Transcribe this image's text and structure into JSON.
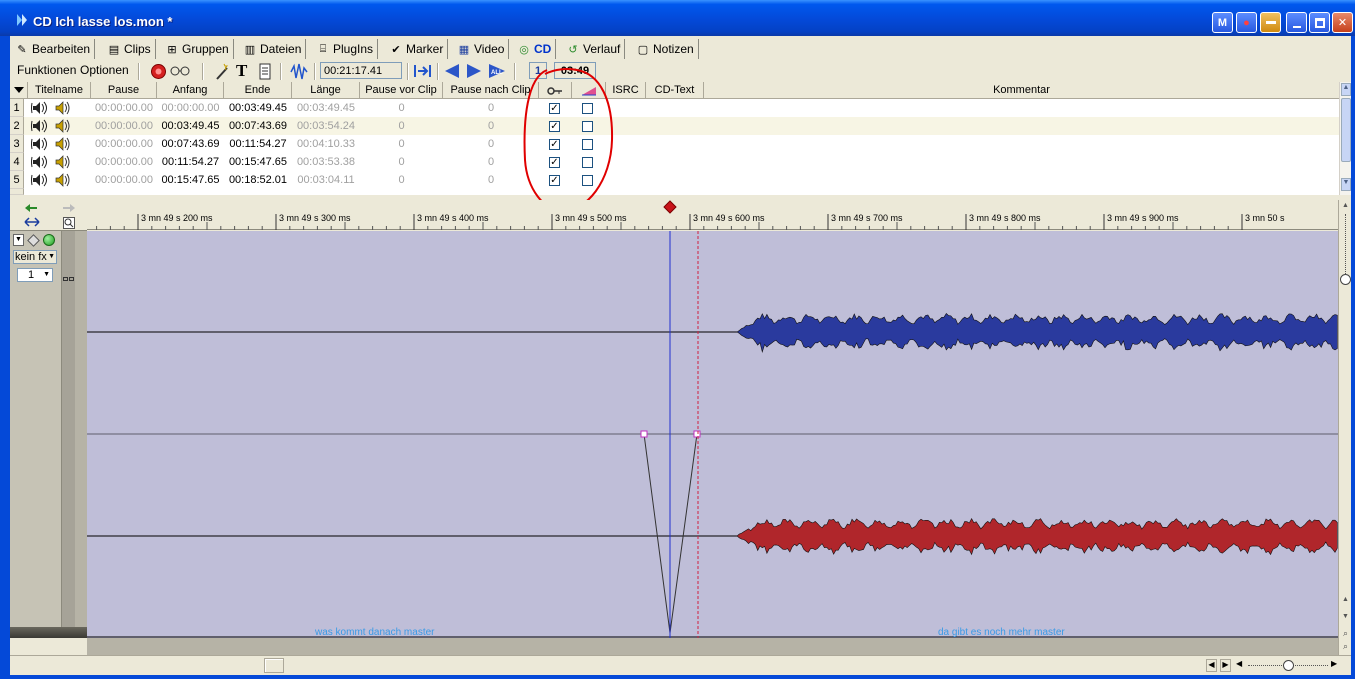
{
  "window": {
    "title": "CD Ich lasse los.mon *",
    "buttons": [
      "M",
      "●",
      "",
      "",
      "",
      "✕"
    ]
  },
  "tabs": [
    {
      "label": "Bearbeiten",
      "icon": "edit-icon"
    },
    {
      "label": "Clips",
      "icon": "clips-icon"
    },
    {
      "label": "Gruppen",
      "icon": "groups-icon"
    },
    {
      "label": "Dateien",
      "icon": "files-icon"
    },
    {
      "label": "PlugIns",
      "icon": "plugins-icon"
    },
    {
      "label": "Marker",
      "icon": "marker-icon"
    },
    {
      "label": "Video",
      "icon": "video-icon"
    },
    {
      "label": "CD",
      "icon": "cd-icon",
      "active": true
    },
    {
      "label": "Verlauf",
      "icon": "history-icon"
    },
    {
      "label": "Notizen",
      "icon": "notes-icon"
    }
  ],
  "toolbar": {
    "menu_functions": "Funktionen",
    "menu_options": "Optionen",
    "total_time": "00:21:17.41",
    "track_number": "1",
    "track_length": "03:49"
  },
  "table": {
    "columns": [
      "Titelname",
      "Pause",
      "Anfang",
      "Ende",
      "Länge",
      "Pause vor Clip",
      "Pause nach Clip",
      "",
      "",
      "ISRC",
      "CD-Text",
      "Kommentar"
    ],
    "rows": [
      {
        "num": "1",
        "pause": "00:00:00.00",
        "start": "00:00:00.00",
        "end": "00:03:49.45",
        "length": "00:03:49.45",
        "pre": "0",
        "post": "0",
        "checked": true,
        "emph": false
      },
      {
        "num": "2",
        "pause": "00:00:00.00",
        "start": "00:03:49.45",
        "end": "00:07:43.69",
        "length": "00:03:54.24",
        "pre": "0",
        "post": "0",
        "checked": true,
        "emph": false
      },
      {
        "num": "3",
        "pause": "00:00:00.00",
        "start": "00:07:43.69",
        "end": "00:11:54.27",
        "length": "00:04:10.33",
        "pre": "0",
        "post": "0",
        "checked": true,
        "emph": false
      },
      {
        "num": "4",
        "pause": "00:00:00.00",
        "start": "00:11:54.27",
        "end": "00:15:47.65",
        "length": "00:03:53.38",
        "pre": "0",
        "post": "0",
        "checked": true,
        "emph": false
      },
      {
        "num": "5",
        "pause": "00:00:00.00",
        "start": "00:15:47.65",
        "end": "00:18:52.01",
        "length": "00:03:04.11",
        "pre": "0",
        "post": "0",
        "checked": true,
        "emph": false
      }
    ]
  },
  "ruler": {
    "labels": [
      "3 mn 49 s 200 ms",
      "3 mn 49 s 300 ms",
      "3 mn 49 s 400 ms",
      "3 mn 49 s 500 ms",
      "3 mn 49 s 600 ms",
      "3 mn 49 s 700 ms",
      "3 mn 49 s 800 ms",
      "3 mn 49 s 900 ms",
      "3 mn 50 s"
    ]
  },
  "track_controls": {
    "fx": "kein fx",
    "channel": "1"
  },
  "clips": {
    "left": "was kommt danach master",
    "right": "da gibt es noch mehr master"
  },
  "colors": {
    "title_blue": "#0449d8",
    "timeline_bg": "#bfbed8",
    "wave_top": "#2a3a9e",
    "wave_bottom": "#b0262b",
    "annotation": "#e00000",
    "clip_label": "#3a9ae6"
  }
}
